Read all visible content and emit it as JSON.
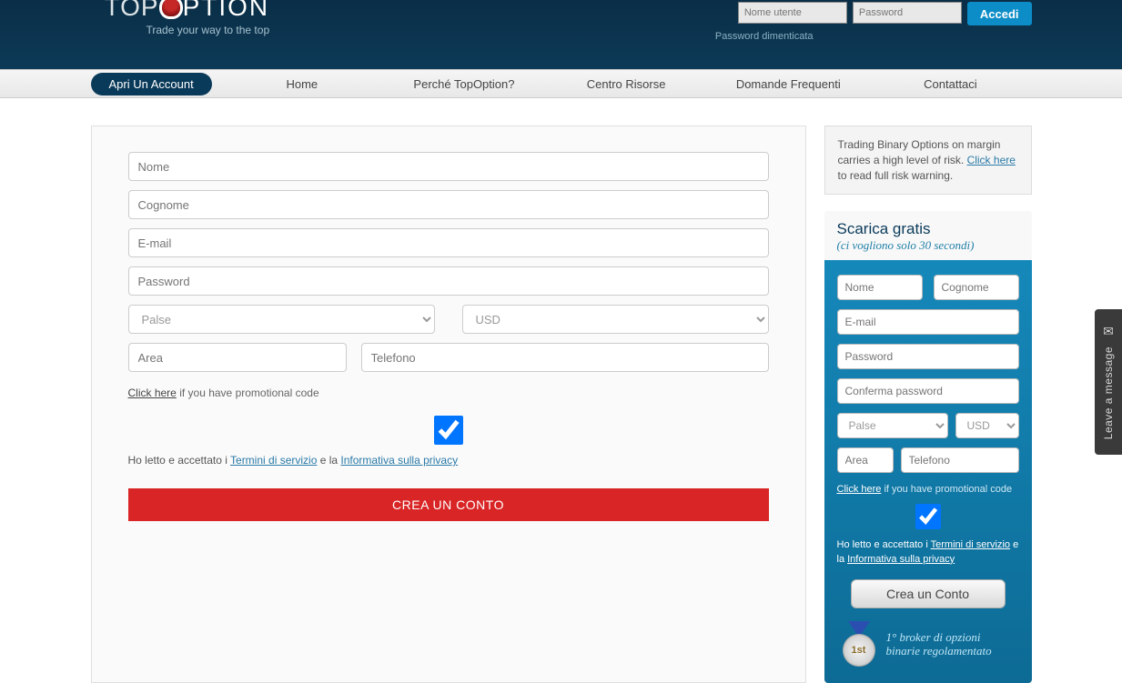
{
  "header": {
    "brand_top": "TOP",
    "brand_rest": "PTION",
    "tagline": "Trade your way to the top",
    "username_ph": "Nome utente",
    "password_ph": "Password",
    "login_label": "Accedi",
    "forgot": "Password dimenticata"
  },
  "nav": {
    "open_account": "Apri Un Account",
    "items": [
      "Home",
      "Perché TopOption?",
      "Centro Risorse",
      "Domande Frequenti",
      "Contattaci"
    ]
  },
  "form": {
    "nome": "Nome",
    "cognome": "Cognome",
    "email": "E-mail",
    "password": "Password",
    "paese_selected": "Palse",
    "currency_selected": "USD",
    "area": "Area",
    "telefono": "Telefono",
    "promo_link": "Click here",
    "promo_rest": " if you have promotional code",
    "consent_prefix": "Ho letto e accettato i ",
    "terms": "Termini di servizio",
    "consent_mid": " e la ",
    "privacy": "Informativa sulla privacy",
    "submit": "CREA UN CONTO"
  },
  "sidebar": {
    "warn_text": "Trading Binary Options on margin carries a high level of risk. ",
    "warn_link": "Click here",
    "warn_rest": " to read full risk warning.",
    "head_title": "Scarica gratis",
    "head_sub": "(ci vogliono solo 30 secondi)",
    "nome": "Nome",
    "cognome": "Cognome",
    "email": "E-mail",
    "password": "Password",
    "conf_password": "Conferma password",
    "paese_selected": "Palse",
    "currency_selected": "USD",
    "area": "Area",
    "telefono": "Telefono",
    "promo_link": "Click here",
    "promo_rest": " if you have promotional code",
    "consent_prefix": "Ho letto e accettato i ",
    "terms": "Termini di servizio",
    "consent_mid": " e la ",
    "privacy": "Informativa sulla privacy",
    "submit": "Crea un Conto",
    "medal_label": "1st",
    "medal_text": "1° broker di opzioni binarie regolamentato"
  },
  "chat_tab": "Leave a message"
}
